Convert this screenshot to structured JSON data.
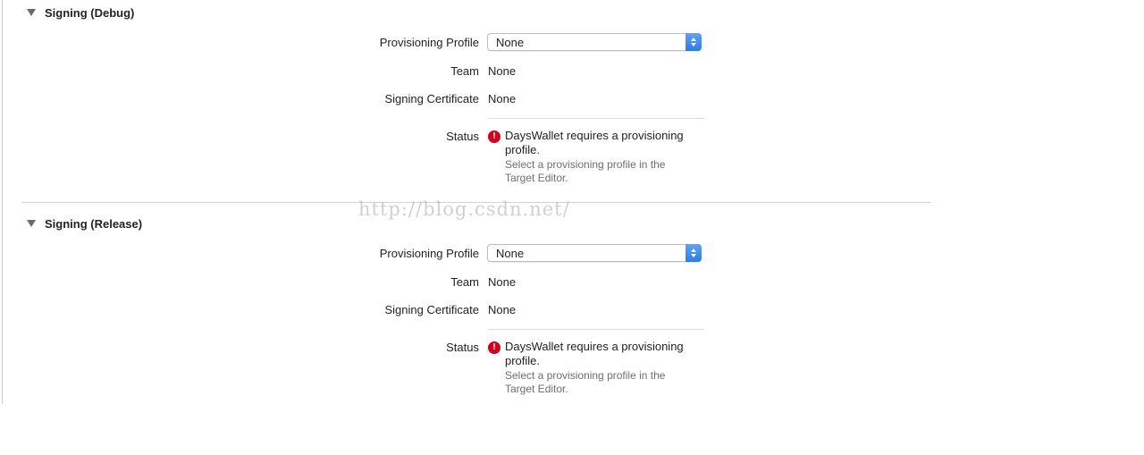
{
  "sections": {
    "debug": {
      "title": "Signing (Debug)",
      "provisioning_profile_label": "Provisioning Profile",
      "provisioning_profile_value": "None",
      "team_label": "Team",
      "team_value": "None",
      "certificate_label": "Signing Certificate",
      "certificate_value": "None",
      "status_label": "Status",
      "status_message": "DaysWallet requires a provisioning profile.",
      "status_detail": "Select a provisioning profile in the Target Editor."
    },
    "release": {
      "title": "Signing (Release)",
      "provisioning_profile_label": "Provisioning Profile",
      "provisioning_profile_value": "None",
      "team_label": "Team",
      "team_value": "None",
      "certificate_label": "Signing Certificate",
      "certificate_value": "None",
      "status_label": "Status",
      "status_message": "DaysWallet requires a provisioning profile.",
      "status_detail": "Select a provisioning profile in the Target Editor."
    }
  },
  "watermark": "http://blog.csdn.net/",
  "icons": {
    "disclosure": "disclosure-triangle-icon",
    "error": "error-icon",
    "stepper": "popup-stepper-icon"
  },
  "colors": {
    "error": "#d0021b",
    "accent": "#2f7be6",
    "secondary_text": "#6e6e6e"
  }
}
